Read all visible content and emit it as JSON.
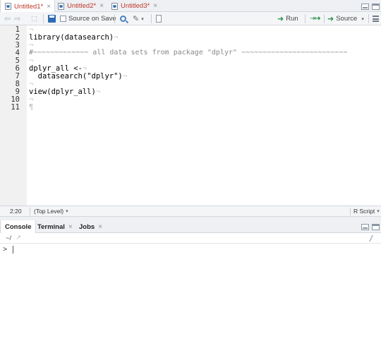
{
  "editor_tabs": [
    {
      "label": "Untitled1*",
      "active": true
    },
    {
      "label": "Untitled2*",
      "active": false
    },
    {
      "label": "Untitled3*",
      "active": false
    }
  ],
  "toolbar": {
    "source_on_save_label": "Source on Save",
    "run_label": "Run",
    "source_label": "Source"
  },
  "editor": {
    "line_numbers": [
      "1",
      "2",
      "3",
      "4",
      "5",
      "6",
      "7",
      "8",
      "9",
      "10",
      "11"
    ],
    "lines": [
      {
        "code": "",
        "ws": "¬"
      },
      {
        "code": "library(datasearch)",
        "ws": "¬"
      },
      {
        "code": "",
        "ws": "¬"
      },
      {
        "code": "#~~~~~~~~~~~~~ all data sets from package \"dplyr\" ~~~~~~~~~~~~~~~~~~~~~~~~~",
        "ws": ""
      },
      {
        "code": "",
        "ws": "¬"
      },
      {
        "code": "dplyr_all <-",
        "ws": "¬"
      },
      {
        "code": "  datasearch(\"dplyr\")",
        "ws": "¬"
      },
      {
        "code": "",
        "ws": "¬"
      },
      {
        "code": "view(dplyr_all)",
        "ws": "¬"
      },
      {
        "code": "",
        "ws": "¬"
      },
      {
        "code": "",
        "ws": "¶"
      }
    ]
  },
  "status": {
    "position": "2:20",
    "scope": "(Top Level)",
    "filetype": "R Script"
  },
  "console_tabs": [
    {
      "label": "Console",
      "active": true
    },
    {
      "label": "Terminal",
      "active": false
    },
    {
      "label": "Jobs",
      "active": false
    }
  ],
  "console": {
    "path": "~/",
    "prompt": ">"
  },
  "colors": {
    "modified_tab": "#c0392b",
    "run_green": "#2f8f4e",
    "accent_blue": "#2e6bb2"
  }
}
